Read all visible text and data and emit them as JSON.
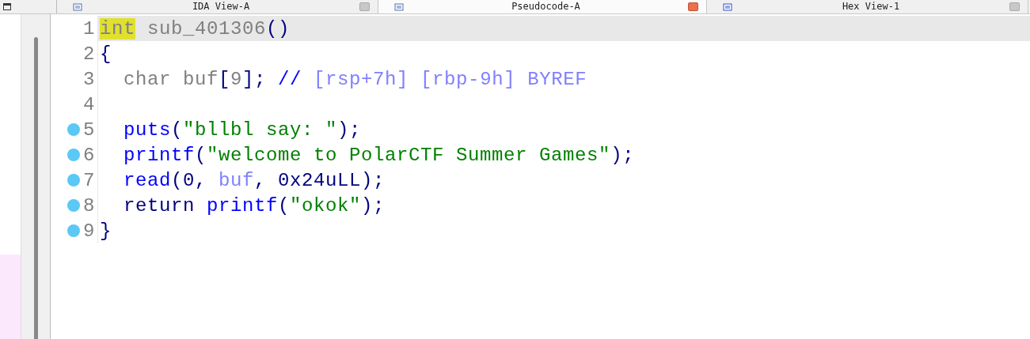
{
  "tabs": [
    {
      "label": "IDA View-A",
      "selected": false,
      "kind": "disassembly"
    },
    {
      "label": "Pseudocode-A",
      "selected": true,
      "kind": "pseudocode"
    },
    {
      "label": "Hex View-1",
      "selected": false,
      "kind": "hex"
    }
  ],
  "code": {
    "lines": [
      {
        "number": "1",
        "current": true,
        "breakpoint": false,
        "tokens": [
          {
            "kind": "keyword",
            "text": "int",
            "highlighted": true
          },
          {
            "kind": "name",
            "text": " sub_401306"
          },
          {
            "kind": "punct",
            "text": "()"
          }
        ]
      },
      {
        "number": "2",
        "current": false,
        "breakpoint": false,
        "tokens": [
          {
            "kind": "punct",
            "text": "{"
          }
        ]
      },
      {
        "number": "3",
        "current": false,
        "breakpoint": false,
        "tokens": [
          {
            "kind": "name",
            "text": "  char buf"
          },
          {
            "kind": "punct",
            "text": "["
          },
          {
            "kind": "name",
            "text": "9"
          },
          {
            "kind": "punct",
            "text": "];"
          },
          {
            "kind": "comment",
            "text": " // "
          },
          {
            "kind": "stackvar",
            "text": "[rsp+7h] [rbp-9h] BYREF"
          }
        ]
      },
      {
        "number": "4",
        "current": false,
        "breakpoint": false
      },
      {
        "number": "5",
        "current": false,
        "breakpoint": true,
        "tokens": [
          {
            "kind": "func",
            "text": "  puts"
          },
          {
            "kind": "punct",
            "text": "("
          },
          {
            "kind": "string",
            "text": "\"bllbl say: \""
          },
          {
            "kind": "punct",
            "text": ");"
          }
        ]
      },
      {
        "number": "6",
        "current": false,
        "breakpoint": true,
        "tokens": [
          {
            "kind": "func",
            "text": "  printf"
          },
          {
            "kind": "punct",
            "text": "("
          },
          {
            "kind": "string",
            "text": "\"welcome to PolarCTF Summer Games\""
          },
          {
            "kind": "punct",
            "text": ");"
          }
        ]
      },
      {
        "number": "7",
        "current": false,
        "breakpoint": true,
        "tokens": [
          {
            "kind": "func",
            "text": "  read"
          },
          {
            "kind": "punct",
            "text": "(0, "
          },
          {
            "kind": "stackvar",
            "text": "buf"
          },
          {
            "kind": "punct",
            "text": ", 0x24uLL);"
          }
        ]
      },
      {
        "number": "8",
        "current": false,
        "breakpoint": true,
        "tokens": [
          {
            "kind": "punct",
            "text": "  return "
          },
          {
            "kind": "func",
            "text": "printf"
          },
          {
            "kind": "punct",
            "text": "("
          },
          {
            "kind": "string",
            "text": "\"okok\""
          },
          {
            "kind": "punct",
            "text": ");"
          }
        ]
      },
      {
        "number": "9",
        "current": false,
        "breakpoint": true,
        "tokens": [
          {
            "kind": "punct",
            "text": "}"
          }
        ]
      }
    ]
  }
}
